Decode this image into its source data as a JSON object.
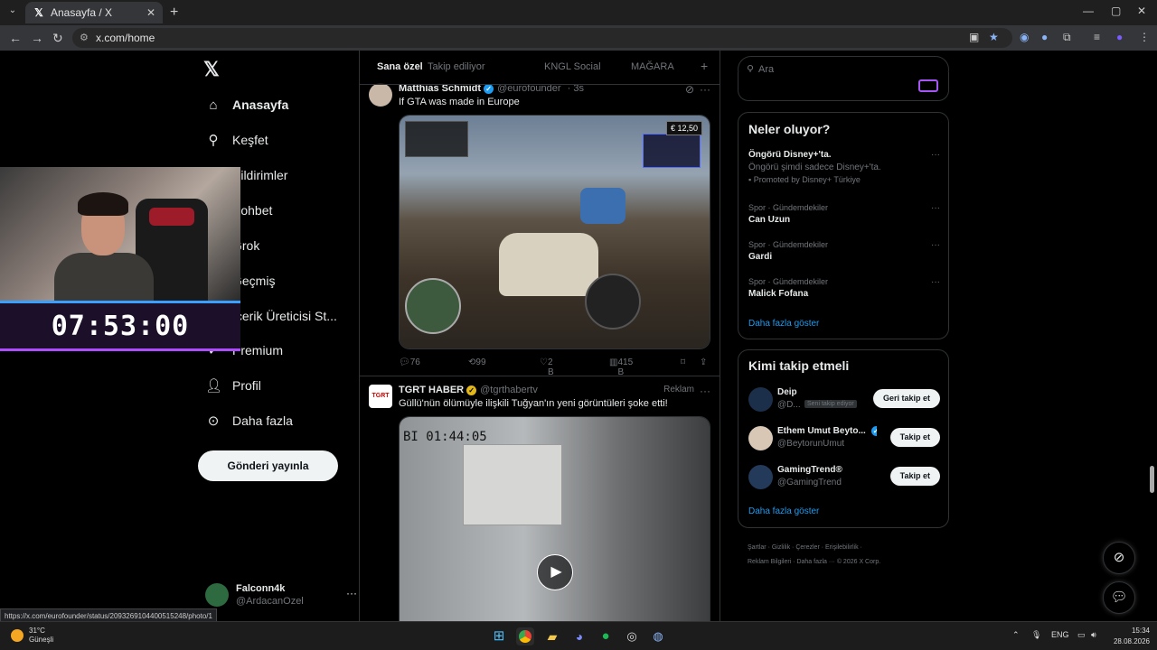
{
  "browser": {
    "tab_title": "Anasayfa / X",
    "url": "x.com/home"
  },
  "nav": {
    "items": [
      {
        "label": "Anasayfa",
        "icon": "home-icon"
      },
      {
        "label": "Keşfet",
        "icon": "search-icon"
      },
      {
        "label": "Bildirimler",
        "icon": "bell-icon"
      },
      {
        "label": "Sohbet",
        "icon": "chat-icon"
      },
      {
        "label": "Grok",
        "icon": "grok-icon"
      },
      {
        "label": "Geçmiş",
        "icon": "history-icon"
      },
      {
        "label": "İçerik Üreticisi St...",
        "icon": "creator-icon"
      },
      {
        "label": "Premium",
        "icon": "premium-icon"
      },
      {
        "label": "Profil",
        "icon": "profile-icon"
      },
      {
        "label": "Daha fazla",
        "icon": "more-icon"
      }
    ],
    "post_button": "Gönderi yayınla",
    "account": {
      "name": "Falconn4k",
      "handle": "@ArdacanOzel"
    }
  },
  "stream_overlay": {
    "timer": "07:53:00"
  },
  "feed": {
    "tabs": [
      "Sana özel",
      "Takip ediliyor",
      "KNGL Social",
      "MAĞARA"
    ],
    "tweets": [
      {
        "name": "Matthias Schmidt",
        "handle": "@eurofounder",
        "time": "· 3s",
        "text": "If GTA was made in Europe",
        "image_price": "€ 12,50",
        "replies": "76",
        "reposts": "99",
        "likes": "2 B",
        "views": "415 B"
      },
      {
        "name": "TGRT HABER",
        "handle": "@tgrthabertv",
        "badge": "Reklam",
        "text": "Güllü'nün ölümüyle ilişkili Tuğyan'ın yeni görüntüleri şoke etti!",
        "video_timestamp": "BI 01:44:05"
      }
    ]
  },
  "right": {
    "search_placeholder": "Ara",
    "trends_title": "Neler oluyor?",
    "trends": [
      {
        "meta": "",
        "title": "Öngörü Disney+'ta.",
        "sub": "Öngörü şimdi sadece Disney+'ta.",
        "promo": "Promoted by Disney+ Türkiye"
      },
      {
        "meta": "Spor · Gündemdekiler",
        "title": "Can Uzun"
      },
      {
        "meta": "Spor · Gündemdekiler",
        "title": "Gardi"
      },
      {
        "meta": "Spor · Gündemdekiler",
        "title": "Malick Fofana"
      }
    ],
    "show_more": "Daha fazla göster",
    "who_title": "Kimi takip etmeli",
    "who": [
      {
        "name": "Deip",
        "handle": "@D...",
        "follows_you": "Seni takip ediyor",
        "button": "Geri takip et"
      },
      {
        "name": "Ethem Umut Beyto...",
        "handle": "@BeytorunUmut",
        "button": "Takip et"
      },
      {
        "name": "GamingTrend®",
        "handle": "@GamingTrend",
        "button": "Takip et"
      }
    ],
    "footer": [
      "Şartlar",
      "Gizlilik",
      "Çerezler",
      "Erişilebilirlik",
      "Reklam Bilgileri",
      "Daha fazla ···",
      "© 2026 X Corp."
    ]
  },
  "status_url": "https://x.com/eurofounder/status/2093269104400515248/photo/1",
  "taskbar": {
    "temp": "31°C",
    "weather": "Güneşli",
    "lang": "ENG",
    "time": "15:34",
    "date": "28.08.2026"
  }
}
